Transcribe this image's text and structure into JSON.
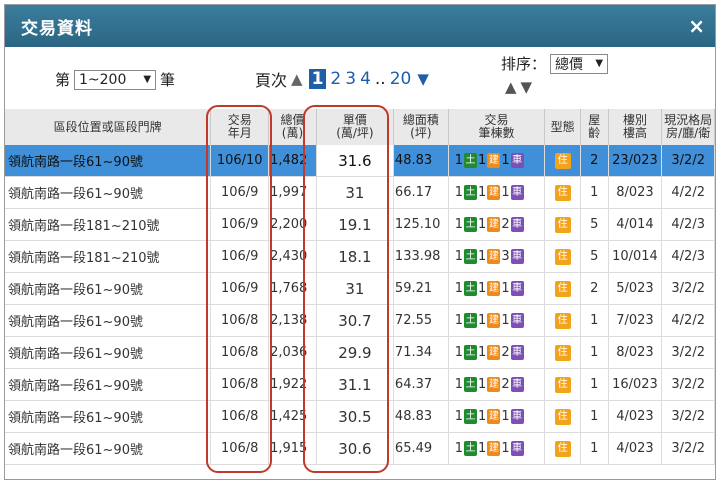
{
  "dialog": {
    "title": "交易資料",
    "close_label": "×"
  },
  "pager": {
    "prefix": "第",
    "range_value": "1~200",
    "suffix": "筆",
    "page_label": "頁次",
    "pages": [
      {
        "label": "1",
        "current": true
      },
      {
        "label": "2",
        "current": false
      },
      {
        "label": "3",
        "current": false
      },
      {
        "label": "4",
        "current": false
      }
    ],
    "ellipsis": "..",
    "last_page": "20"
  },
  "sort": {
    "label": "排序：",
    "value": "總價"
  },
  "headers": [
    {
      "l1": "區段位置或區段門牌",
      "l2": ""
    },
    {
      "l1": "交易",
      "l2": "年月"
    },
    {
      "l1": "總價",
      "l2": "(萬)"
    },
    {
      "l1": "單價",
      "l2": "(萬/坪)"
    },
    {
      "l1": "總面積",
      "l2": "(坪)"
    },
    {
      "l1": "交易",
      "l2": "筆棟數"
    },
    {
      "l1": "型態",
      "l2": ""
    },
    {
      "l1": "屋",
      "l2": "齡"
    },
    {
      "l1": "樓別",
      "l2": "樓高"
    },
    {
      "l1": "現況格局",
      "l2": "房/廳/衛"
    }
  ],
  "badges": {
    "land": "土",
    "building": "建",
    "parking": "車",
    "type": "住"
  },
  "rows": [
    {
      "addr": "領航南路一段61~90號",
      "date": "106/10",
      "total": "1,482",
      "unit": "31.6",
      "area": "48.83",
      "land": "1",
      "bld": "1",
      "car": "1",
      "age": "2",
      "floor": "23/023",
      "layout": "3/2/2"
    },
    {
      "addr": "領航南路一段61~90號",
      "date": "106/9",
      "total": "1,997",
      "unit": "31",
      "area": "66.17",
      "land": "1",
      "bld": "1",
      "car": "1",
      "age": "1",
      "floor": "8/023",
      "layout": "4/2/2"
    },
    {
      "addr": "領航南路一段181~210號",
      "date": "106/9",
      "total": "2,200",
      "unit": "19.1",
      "area": "125.10",
      "land": "1",
      "bld": "1",
      "car": "2",
      "age": "5",
      "floor": "4/014",
      "layout": "4/2/3"
    },
    {
      "addr": "領航南路一段181~210號",
      "date": "106/9",
      "total": "2,430",
      "unit": "18.1",
      "area": "133.98",
      "land": "1",
      "bld": "1",
      "car": "3",
      "age": "5",
      "floor": "10/014",
      "layout": "4/2/3"
    },
    {
      "addr": "領航南路一段61~90號",
      "date": "106/9",
      "total": "1,768",
      "unit": "31",
      "area": "59.21",
      "land": "1",
      "bld": "1",
      "car": "1",
      "age": "2",
      "floor": "5/023",
      "layout": "3/2/2"
    },
    {
      "addr": "領航南路一段61~90號",
      "date": "106/8",
      "total": "2,138",
      "unit": "30.7",
      "area": "72.55",
      "land": "1",
      "bld": "1",
      "car": "1",
      "age": "1",
      "floor": "7/023",
      "layout": "4/2/2"
    },
    {
      "addr": "領航南路一段61~90號",
      "date": "106/8",
      "total": "2,036",
      "unit": "29.9",
      "area": "71.34",
      "land": "1",
      "bld": "1",
      "car": "2",
      "age": "1",
      "floor": "8/023",
      "layout": "3/2/2"
    },
    {
      "addr": "領航南路一段61~90號",
      "date": "106/8",
      "total": "1,922",
      "unit": "31.1",
      "area": "64.37",
      "land": "1",
      "bld": "1",
      "car": "2",
      "age": "1",
      "floor": "16/023",
      "layout": "3/2/2"
    },
    {
      "addr": "領航南路一段61~90號",
      "date": "106/8",
      "total": "1,425",
      "unit": "30.5",
      "area": "48.83",
      "land": "1",
      "bld": "1",
      "car": "1",
      "age": "1",
      "floor": "4/023",
      "layout": "3/2/2"
    },
    {
      "addr": "領航南路一段61~90號",
      "date": "106/8",
      "total": "1,915",
      "unit": "30.6",
      "area": "65.49",
      "land": "1",
      "bld": "1",
      "car": "1",
      "age": "1",
      "floor": "4/023",
      "layout": "3/2/2"
    }
  ]
}
